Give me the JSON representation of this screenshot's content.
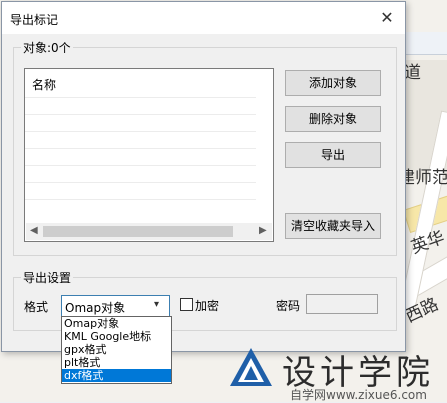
{
  "dialog": {
    "title": "导出标记",
    "close_glyph": "✕",
    "objects_legend": "对象:0个",
    "list_header": "名称",
    "buttons": {
      "add": "添加对象",
      "delete": "删除对象",
      "export": "导出",
      "import_clear": "清空收藏夹导入"
    },
    "export_settings": {
      "legend": "导出设置",
      "format_label": "格式",
      "format_value": "Omap对象",
      "encrypt_label": "加密",
      "encrypt_checked": false,
      "password_label": "密码",
      "password_value": ""
    },
    "format_options": [
      "Omap对象",
      "KML Google地标",
      "gpx格式",
      "plt格式",
      "dxf格式"
    ],
    "selected_option_index": 4
  },
  "map": {
    "labels": [
      "道",
      "建师范",
      "英华",
      "西路"
    ]
  },
  "watermark": {
    "main": "设计学院",
    "sub": "自学网www.zixue6.com"
  }
}
